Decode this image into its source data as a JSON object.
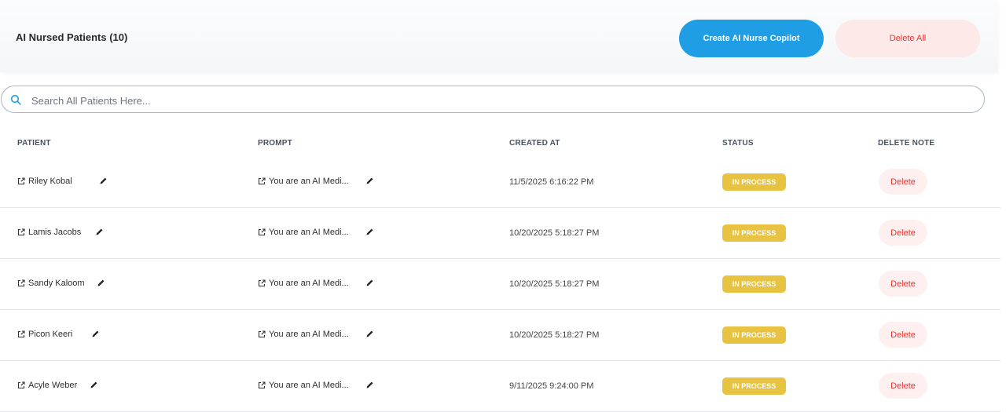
{
  "header": {
    "title": "AI Nursed Patients (10)",
    "create_label": "Create AI Nurse Copilot",
    "delete_all_label": "Delete All"
  },
  "search": {
    "placeholder": "Search All Patients Here...",
    "value": ""
  },
  "table": {
    "columns": [
      "PATIENT",
      "PROMPT",
      "CREATED AT",
      "STATUS",
      "DELETE NOTE"
    ],
    "rows": [
      {
        "patient": "Riley Kobal",
        "prompt": "You are an AI Medi...",
        "created_at": "11/5/2025 6:16:22 PM",
        "status": "IN PROCESS",
        "delete_label": "Delete"
      },
      {
        "patient": "Lamis Jacobs",
        "prompt": "You are an AI Medi...",
        "created_at": "10/20/2025 5:18:27 PM",
        "status": "IN PROCESS",
        "delete_label": "Delete"
      },
      {
        "patient": "Sandy Kaloom",
        "prompt": "You are an AI Medi...",
        "created_at": "10/20/2025 5:18:27 PM",
        "status": "IN PROCESS",
        "delete_label": "Delete"
      },
      {
        "patient": "Picon Keeri",
        "prompt": "You are an AI Medi...",
        "created_at": "10/20/2025 5:18:27 PM",
        "status": "IN PROCESS",
        "delete_label": "Delete"
      },
      {
        "patient": "Acyle Weber",
        "prompt": "You are an AI Medi...",
        "created_at": "9/11/2025 9:24:00 PM",
        "status": "IN PROCESS",
        "delete_label": "Delete"
      }
    ]
  },
  "icons": {
    "search": "search-icon",
    "link": "external-link-icon",
    "edit": "pencil-icon"
  },
  "colors": {
    "primary": "#1f9ee6",
    "danger": "#e53935",
    "danger_bg": "#fde9e7",
    "status_in_process": "#e8c241"
  }
}
